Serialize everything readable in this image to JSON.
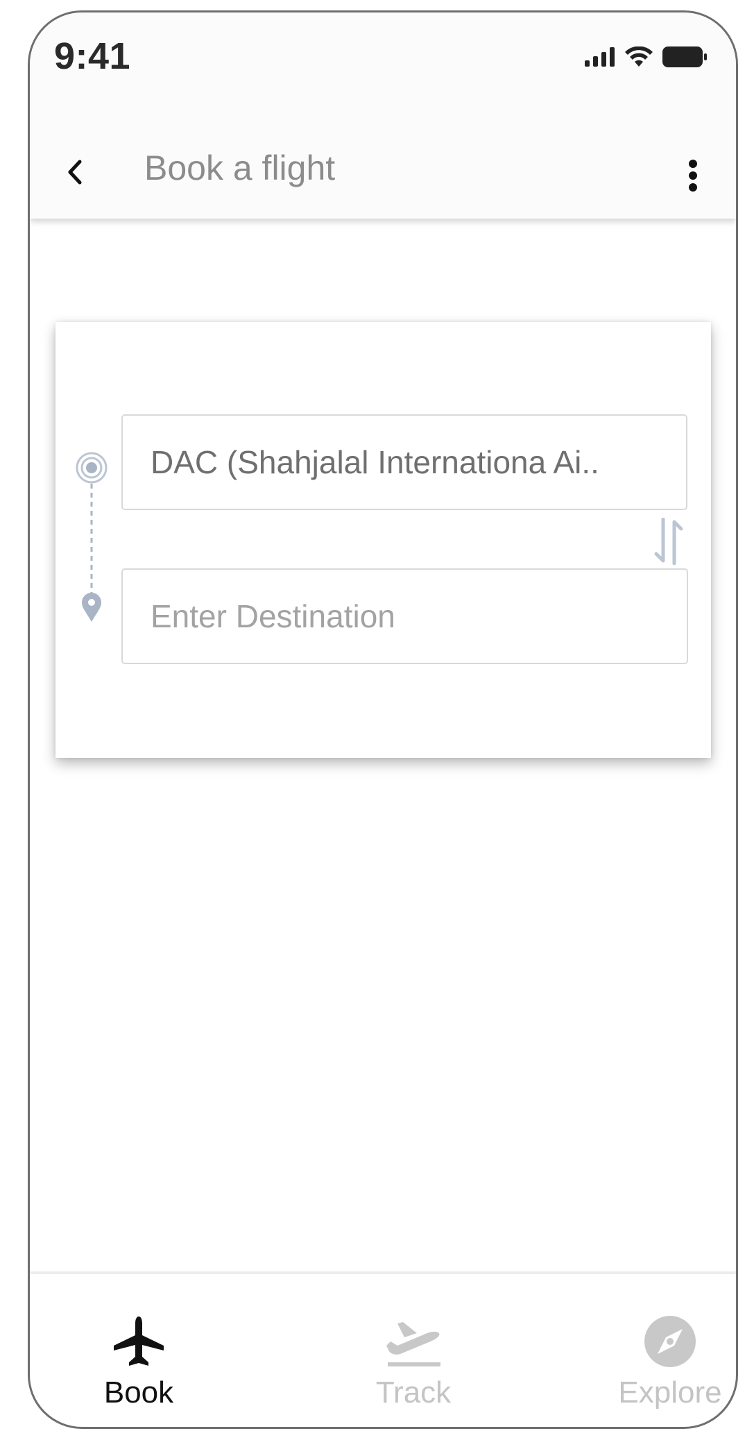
{
  "status_bar": {
    "time": "9:41"
  },
  "header": {
    "title": "Book a flight"
  },
  "search_card": {
    "origin": "DAC (Shahjalal Internationa Ai..",
    "destination_value": "",
    "destination_placeholder": "Enter Destination"
  },
  "tab_bar": {
    "tabs": [
      {
        "label": "Book",
        "icon": "airplane-icon",
        "active": true
      },
      {
        "label": "Track",
        "icon": "flight-takeoff-icon",
        "active": false
      },
      {
        "label": "Explore",
        "icon": "compass-icon",
        "active": false
      }
    ]
  },
  "colors": {
    "active_tab": "#111111",
    "inactive_tab": "#c4c4c4",
    "route_marker": "#a9b4c5",
    "title_text": "#8c8c8c"
  }
}
